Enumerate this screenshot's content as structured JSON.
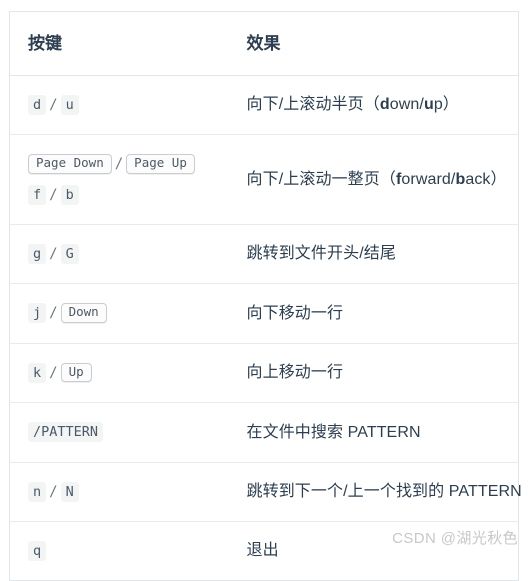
{
  "table": {
    "headers": {
      "key": "按键",
      "effect": "效果"
    },
    "rows": [
      {
        "key_parts": [
          {
            "type": "code",
            "text": "d"
          },
          {
            "type": "sep",
            "text": "/"
          },
          {
            "type": "code",
            "text": "u"
          }
        ],
        "key_plain": "d / u",
        "effect_prefix": "向下/上滚动半页（",
        "effect_bold1": "d",
        "effect_mid1": "own/",
        "effect_bold2": "u",
        "effect_suffix": "p）",
        "effect_plain": "向下/上滚动半页（down/up）"
      },
      {
        "key_parts": [
          {
            "type": "kbd",
            "text": "Page Down"
          },
          {
            "type": "sep",
            "text": "/"
          },
          {
            "type": "kbd",
            "text": "Page Up"
          },
          {
            "type": "break",
            "text": ""
          },
          {
            "type": "code",
            "text": "f"
          },
          {
            "type": "sep",
            "text": "/"
          },
          {
            "type": "code",
            "text": "b"
          }
        ],
        "key_plain": "Page Down / Page Up   f / b",
        "effect_prefix": "向下/上滚动一整页（",
        "effect_bold1": "f",
        "effect_mid1": "orward/",
        "effect_bold2": "b",
        "effect_suffix": "ack）",
        "effect_plain": "向下/上滚动一整页（forward/back）"
      },
      {
        "key_parts": [
          {
            "type": "code",
            "text": "g"
          },
          {
            "type": "sep",
            "text": "/"
          },
          {
            "type": "code",
            "text": "G"
          }
        ],
        "key_plain": "g / G",
        "effect_plain": "跳转到文件开头/结尾"
      },
      {
        "key_parts": [
          {
            "type": "code",
            "text": "j"
          },
          {
            "type": "sep",
            "text": "/"
          },
          {
            "type": "kbd",
            "text": "Down"
          }
        ],
        "key_plain": "j / Down",
        "effect_plain": "向下移动一行"
      },
      {
        "key_parts": [
          {
            "type": "code",
            "text": "k"
          },
          {
            "type": "sep",
            "text": "/"
          },
          {
            "type": "kbd",
            "text": "Up"
          }
        ],
        "key_plain": "k / Up",
        "effect_plain": "向上移动一行"
      },
      {
        "key_parts": [
          {
            "type": "code",
            "text": "/PATTERN"
          }
        ],
        "key_plain": "/PATTERN",
        "effect_plain": "在文件中搜索 PATTERN"
      },
      {
        "key_parts": [
          {
            "type": "code",
            "text": "n"
          },
          {
            "type": "sep",
            "text": "/"
          },
          {
            "type": "code",
            "text": "N"
          }
        ],
        "key_plain": "n / N",
        "effect_plain": "跳转到下一个/上一个找到的 PATTERN"
      },
      {
        "key_parts": [
          {
            "type": "code",
            "text": "q"
          }
        ],
        "key_plain": "q",
        "effect_plain": "退出"
      }
    ]
  },
  "watermark": {
    "text": "CSDN @湖光秋色"
  },
  "colors": {
    "text": "#2c3e50",
    "code_bg": "#f3f4f4",
    "code_text": "#4a5a68",
    "kbd_border": "#c9cdd1",
    "table_border": "#e3e6e8",
    "row_divider": "#e8eaec",
    "watermark": "#c8c8c8"
  }
}
